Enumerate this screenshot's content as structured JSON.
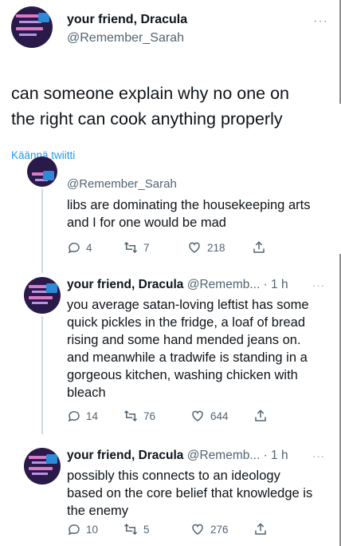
{
  "main_tweet": {
    "name": "your friend, Dracula",
    "handle": "@Remember_Sarah",
    "more": "···",
    "text_line1": "can someone explain why no one on",
    "text_line2": "the right can cook anything properly",
    "translate": "Käännä twiitti"
  },
  "reply1": {
    "handle": "@Remember_Sarah",
    "line1": "libs are dominating the housekeeping arts",
    "line2": "and I for one would be mad",
    "replies": "4",
    "retweets": "7",
    "likes": "218"
  },
  "reply2": {
    "name": "your friend, Dracula",
    "meta": "@Rememb... · 1 h",
    "more": "···",
    "line1": "you average satan-loving leftist has some",
    "line2": "quick pickles in the fridge, a loaf of bread",
    "line3": "rising and some hand mended jeans on.",
    "line4": "and meanwhile a tradwife is standing in a",
    "line5": "gorgeous kitchen, washing chicken with",
    "line6": "bleach",
    "replies": "14",
    "retweets": "76",
    "likes": "644"
  },
  "reply3": {
    "name": "your friend, Dracula",
    "meta": "@Rememb... · 1 h",
    "more": "···",
    "line1": "possibly this connects to an ideology",
    "line2": "based on the core belief that knowledge is",
    "line3": "the enemy",
    "replies": "10",
    "retweets": "5",
    "likes": "276"
  },
  "colors": {
    "link": "#1d9bf0",
    "muted": "#536471",
    "line": "#cfd9de"
  }
}
